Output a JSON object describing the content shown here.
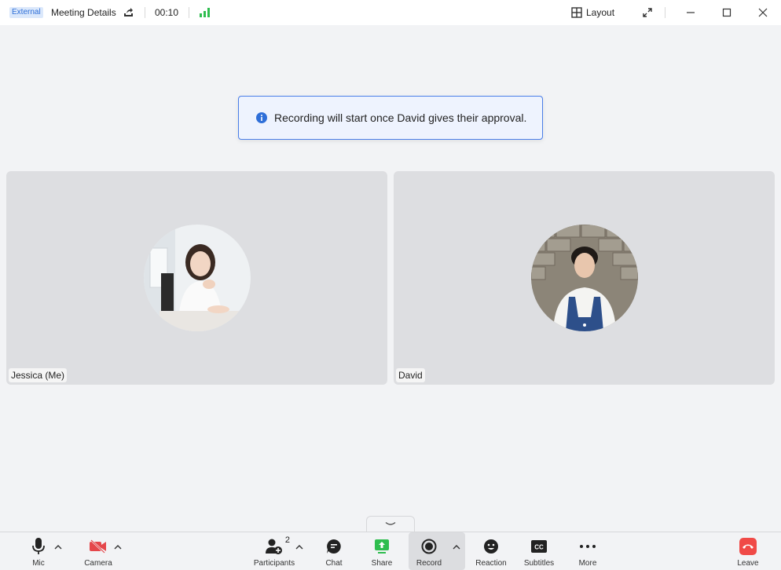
{
  "titlebar": {
    "badge": "External",
    "meeting_details": "Meeting Details",
    "timer": "00:10",
    "layout_label": "Layout"
  },
  "notification": {
    "text": "Recording will start once David gives their approval."
  },
  "tiles": [
    {
      "name": "Jessica (Me)"
    },
    {
      "name": "David"
    }
  ],
  "toolbar": {
    "mic": "Mic",
    "camera": "Camera",
    "participants": "Participants",
    "participants_count": "2",
    "chat": "Chat",
    "share": "Share",
    "record": "Record",
    "reaction": "Reaction",
    "subtitles": "Subtitles",
    "more": "More",
    "leave": "Leave"
  },
  "colors": {
    "accent": "#2f6fd8",
    "share_green": "#2ebd4e",
    "leave_red": "#f04a47",
    "camera_off_red": "#e5474b"
  }
}
